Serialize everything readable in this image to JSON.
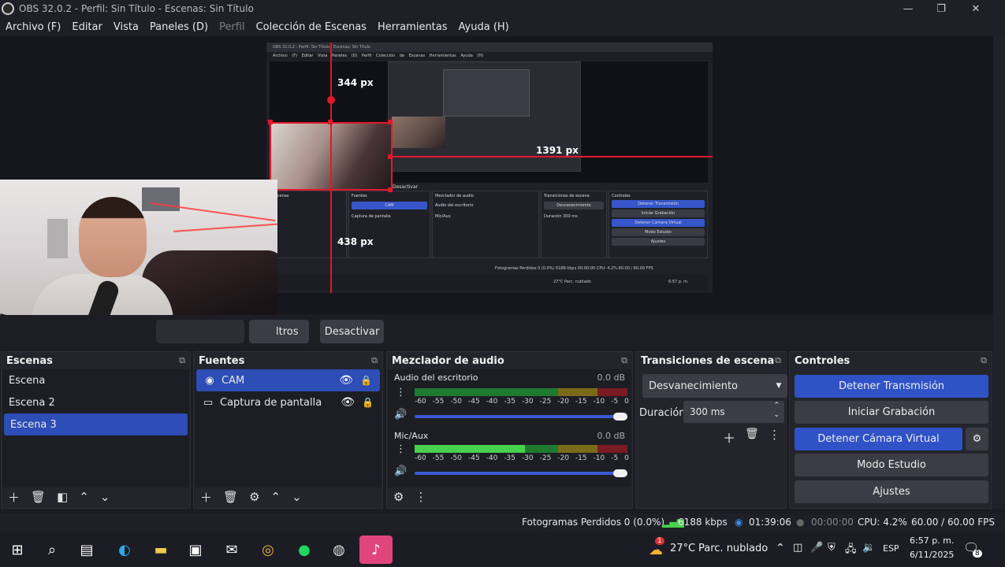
{
  "window": {
    "title": "OBS 32.0.2 - Perfil: Sin Título - Escenas: Sin Título",
    "minimize_glyph": "—",
    "maximize_glyph": "❐",
    "close_glyph": "✕"
  },
  "menu": [
    "Archivo (F)",
    "Editar",
    "Vista",
    "Paneles (D)",
    "Perfil",
    "Colección de Escenas",
    "Herramientas",
    "Ayuda (H)"
  ],
  "preview": {
    "measure_top": "344 px",
    "measure_right": "1391 px",
    "measure_left": "438 px",
    "inner_title": "OBS 32.0.2 - Perfil: Sin Título - Escenas: Sin Título",
    "inner_menu": "Archivo (F) Editar Vista Paneles (D) Perfil Colección de Escenas Herramientas Ayuda (H)",
    "inner_deactivate": "Desactivar",
    "inner_docks": {
      "scenes": "Escenas",
      "sources": "Fuentes",
      "mixer": "Mezclador de audio",
      "transitions": "Transiciones de escena",
      "controls": "Controles"
    },
    "inner_sources": [
      "CAM",
      "Captura de pantalla"
    ],
    "inner_mixer": [
      "Audio del escritorio",
      "Mic/Aux"
    ],
    "inner_transition": "Desvanecimiento",
    "inner_duration_label": "Duración",
    "inner_duration": "300 ms",
    "inner_buttons": [
      "Detener Transmisión",
      "Iniciar Grabación",
      "Detener Cámara Virtual",
      "Modo Estudio",
      "Ajustes"
    ],
    "inner_status": "Fotogramas Perdidos 0 (0.0%)   6188 kbps   00:00:00   CPU: 4.2%   60.00 / 60.00 FPS",
    "inner_weather": "27°C  Parc. nublado",
    "inner_clock": "6:57 p. m."
  },
  "context_bar": {
    "filters_label": "ltros",
    "deactivate_label": "Desactivar"
  },
  "scenes": {
    "header": "Escenas",
    "items": [
      "Escena",
      "Escena 2",
      "Escena 3"
    ],
    "selected_index": 2
  },
  "sources": {
    "header": "Fuentes",
    "items": [
      {
        "label": "CAM",
        "icon": "camera-icon",
        "selected": true
      },
      {
        "label": "Captura de pantalla",
        "icon": "monitor-icon",
        "selected": false
      }
    ]
  },
  "mixer": {
    "header": "Mezclador de audio",
    "channels": [
      {
        "name": "Audio del escritorio",
        "db": "0.0 dB",
        "level": 0.0
      },
      {
        "name": "Mic/Aux",
        "db": "0.0 dB",
        "level": 0.52
      }
    ],
    "ticks": [
      "-60",
      "-55",
      "-50",
      "-45",
      "-40",
      "-35",
      "-30",
      "-25",
      "-20",
      "-15",
      "-10",
      "-5",
      "0"
    ]
  },
  "transitions": {
    "header": "Transiciones de escena",
    "selected": "Desvanecimiento",
    "duration_label": "Duración",
    "duration_value": "300 ms"
  },
  "controls": {
    "header": "Controles",
    "stop_stream": "Detener Transmisión",
    "start_record": "Iniciar Grabación",
    "stop_virtual_cam": "Detener Cámara Virtual",
    "studio_mode": "Modo Estudio",
    "settings": "Ajustes"
  },
  "status": {
    "dropped_frames": "Fotogramas Perdidos 0 (0.0%)",
    "bitrate": "6188 kbps",
    "stream_time": "01:39:06",
    "record_time": "00:00:00",
    "cpu": "CPU: 4.2%",
    "fps": "60.00 / 60.00 FPS"
  },
  "taskbar": {
    "weather_temp": "27°C",
    "weather_desc": "Parc. nublado",
    "language": "ESP",
    "time": "6:57 p. m.",
    "date": "6/11/2025",
    "notifications": "8",
    "weather_badge": "1"
  },
  "colors": {
    "accent_blue": "#2f52c7",
    "meter_green": "#48d04e",
    "measure_red": "#e0192d"
  }
}
